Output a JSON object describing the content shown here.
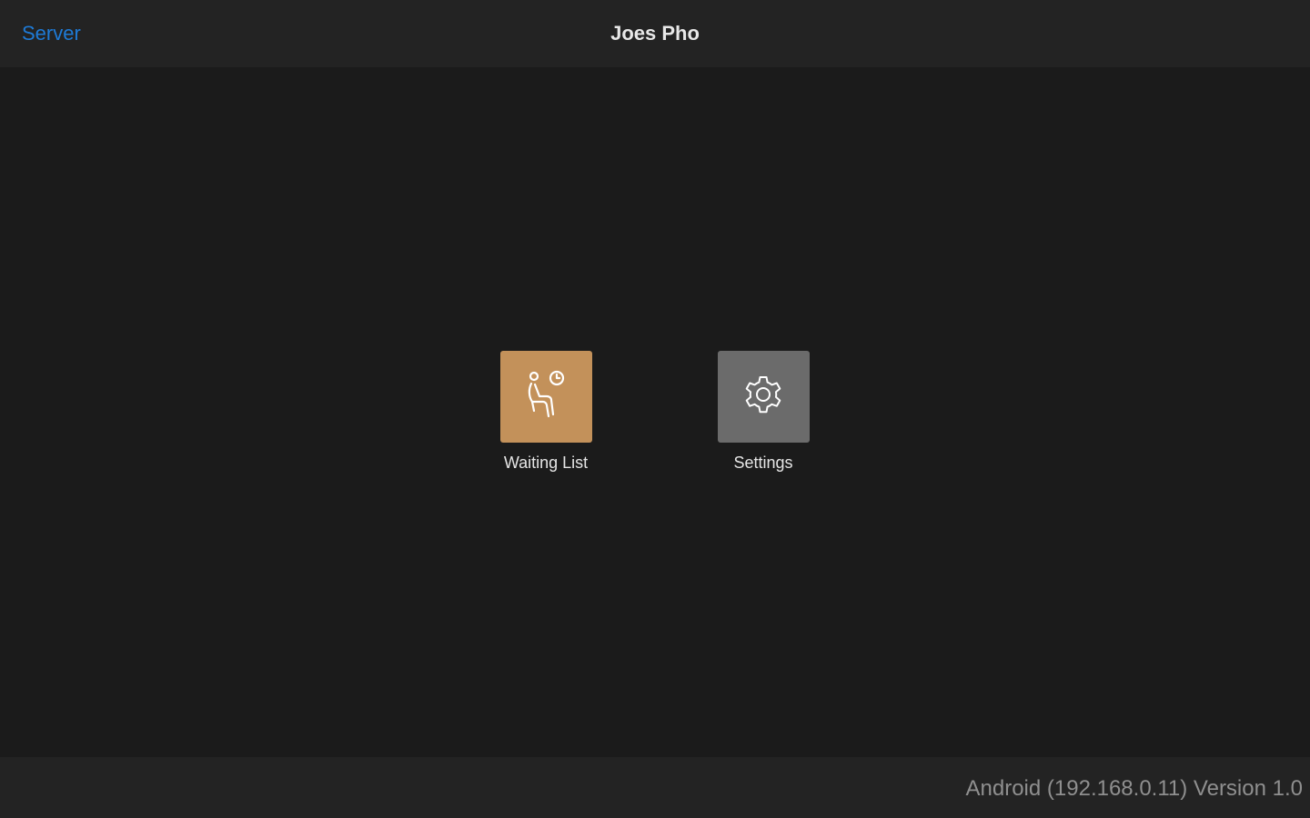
{
  "header": {
    "back_label": "Server",
    "title": "Joes Pho"
  },
  "tiles": [
    {
      "label": "Waiting List",
      "icon": "waiting-person-clock-icon",
      "color": "#c3915a"
    },
    {
      "label": "Settings",
      "icon": "gear-icon",
      "color": "#6b6b6b"
    }
  ],
  "footer": {
    "version_text": "Android (192.168.0.11) Version 1.0"
  },
  "colors": {
    "background": "#1b1b1b",
    "bar": "#232323",
    "accent": "#1e7ad6"
  }
}
